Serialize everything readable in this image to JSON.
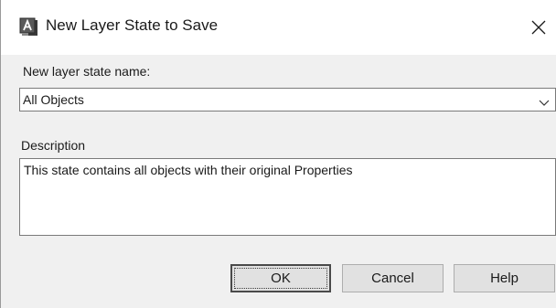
{
  "window": {
    "title": "New Layer State to Save",
    "app_icon": "autocad-app-icon",
    "close_icon": "close-icon"
  },
  "name_field": {
    "label": "New layer state name:",
    "value": "All Objects",
    "dropdown_icon": "chevron-down-icon"
  },
  "description": {
    "label": "Description",
    "value": "This state contains all objects with their original Properties"
  },
  "buttons": {
    "ok": "OK",
    "cancel": "Cancel",
    "help": "Help"
  }
}
